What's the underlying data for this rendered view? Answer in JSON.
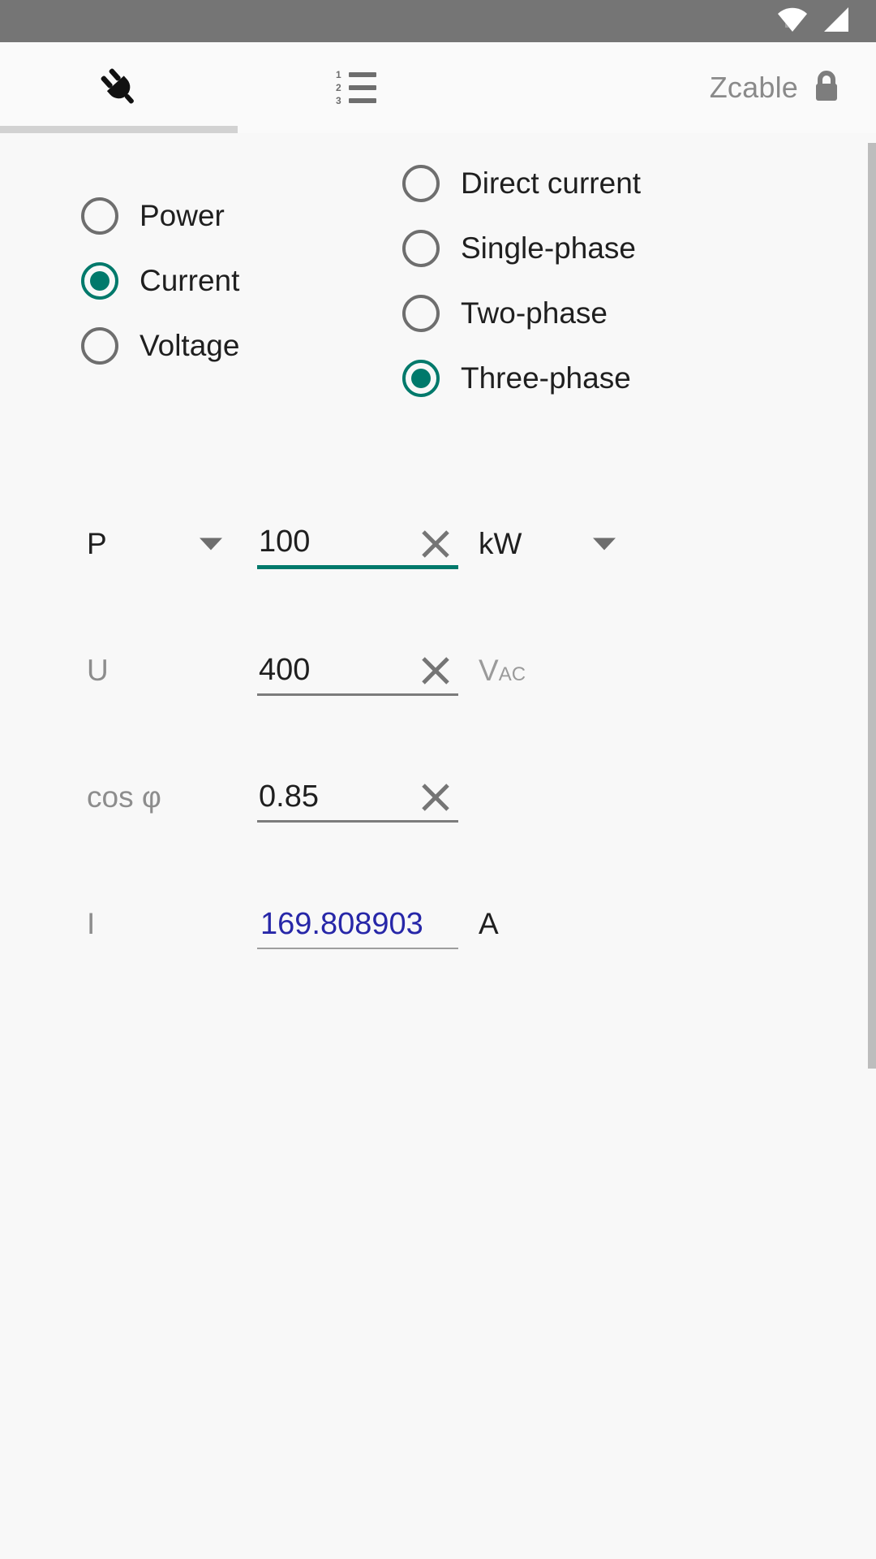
{
  "status_bar": {
    "background": "#757575",
    "icons": [
      "wifi-icon",
      "signal-icon"
    ]
  },
  "app_bar": {
    "title": "Zcable",
    "lock_icon": "lock-closed-icon",
    "tabs": [
      {
        "name": "calculator-tab",
        "icon": "plug-icon",
        "selected": true
      },
      {
        "name": "list-tab",
        "icon": "numbered-list-icon",
        "selected": false
      }
    ],
    "indicator_color": "#d2d2d2"
  },
  "colors": {
    "accent": "#00796b",
    "result": "#2727a8",
    "muted": "#8d8d8d",
    "text": "#1f1f1f",
    "background": "#f8f8f8"
  },
  "quantity_group": {
    "name": "quantity-radio-group",
    "options": [
      {
        "label": "Power",
        "checked": false
      },
      {
        "label": "Current",
        "checked": true
      },
      {
        "label": "Voltage",
        "checked": false
      }
    ]
  },
  "current_type_group": {
    "name": "current-type-radio-group",
    "options": [
      {
        "label": "Direct current",
        "checked": false
      },
      {
        "label": "Single-phase",
        "checked": false
      },
      {
        "label": "Two-phase",
        "checked": false
      },
      {
        "label": "Three-phase",
        "checked": true
      }
    ]
  },
  "fields": [
    {
      "id": "power",
      "label": "P",
      "label_muted": false,
      "has_label_dropdown": true,
      "value": "100",
      "has_clear": true,
      "focused": true,
      "unit": "kW",
      "unit_sub": "",
      "unit_muted": false,
      "has_unit_dropdown": true,
      "readonly": false
    },
    {
      "id": "voltage",
      "label": "U",
      "label_muted": true,
      "has_label_dropdown": false,
      "value": "400",
      "has_clear": true,
      "focused": false,
      "unit": "V",
      "unit_sub": "AC",
      "unit_muted": true,
      "has_unit_dropdown": false,
      "readonly": false
    },
    {
      "id": "power-factor",
      "label": "cos φ",
      "label_muted": true,
      "has_label_dropdown": false,
      "value": "0.85",
      "has_clear": true,
      "focused": false,
      "unit": "",
      "unit_sub": "",
      "unit_muted": true,
      "has_unit_dropdown": false,
      "readonly": false
    },
    {
      "id": "current-result",
      "label": "I",
      "label_muted": true,
      "has_label_dropdown": false,
      "value": "169.808903",
      "has_clear": false,
      "focused": false,
      "unit": "A",
      "unit_sub": "",
      "unit_muted": false,
      "has_unit_dropdown": false,
      "readonly": true
    }
  ]
}
